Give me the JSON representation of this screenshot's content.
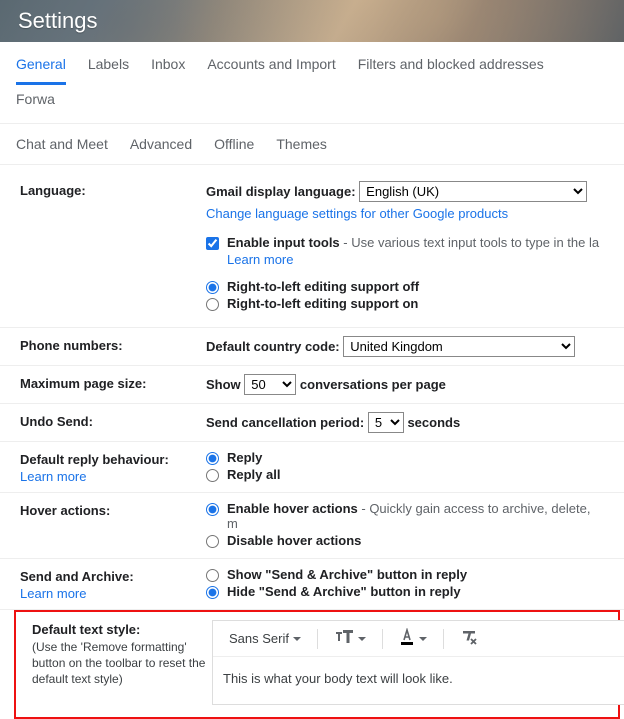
{
  "header": {
    "title": "Settings"
  },
  "tabs_row1": [
    {
      "label": "General",
      "active": true
    },
    {
      "label": "Labels"
    },
    {
      "label": "Inbox"
    },
    {
      "label": "Accounts and Import"
    },
    {
      "label": "Filters and blocked addresses"
    },
    {
      "label": "Forwa"
    }
  ],
  "tabs_row2": [
    {
      "label": "Chat and Meet"
    },
    {
      "label": "Advanced"
    },
    {
      "label": "Offline"
    },
    {
      "label": "Themes"
    }
  ],
  "language": {
    "label": "Language:",
    "display_label": "Gmail display language:",
    "selected": "English (UK)",
    "change_link": "Change language settings for other Google products",
    "enable_tools_label": "Enable input tools",
    "enable_tools_desc": " - Use various text input tools to type in the la",
    "learn_more": "Learn more",
    "rtl_off": "Right-to-left editing support off",
    "rtl_on": "Right-to-left editing support on"
  },
  "phone": {
    "label": "Phone numbers:",
    "cc_label": "Default country code:",
    "selected": "United Kingdom"
  },
  "pagesize": {
    "label": "Maximum page size:",
    "show": "Show",
    "value": "50",
    "suffix": "conversations per page"
  },
  "undo": {
    "label": "Undo Send:",
    "prefix": "Send cancellation period:",
    "value": "5",
    "suffix": "seconds"
  },
  "reply": {
    "label": "Default reply behaviour:",
    "learn_more": "Learn more",
    "opt1": "Reply",
    "opt2": "Reply all"
  },
  "hover": {
    "label": "Hover actions:",
    "opt1": "Enable hover actions",
    "opt1_desc": " - Quickly gain access to archive, delete, m",
    "opt2": "Disable hover actions"
  },
  "sendarchive": {
    "label": "Send and Archive:",
    "learn_more": "Learn more",
    "opt1": "Show \"Send & Archive\" button in reply",
    "opt2": "Hide \"Send & Archive\" button in reply"
  },
  "textstyle": {
    "label": "Default text style:",
    "sub": "(Use the 'Remove formatting' button on the toolbar to reset the default text style)",
    "font": "Sans Serif",
    "preview": "This is what your body text will look like."
  }
}
